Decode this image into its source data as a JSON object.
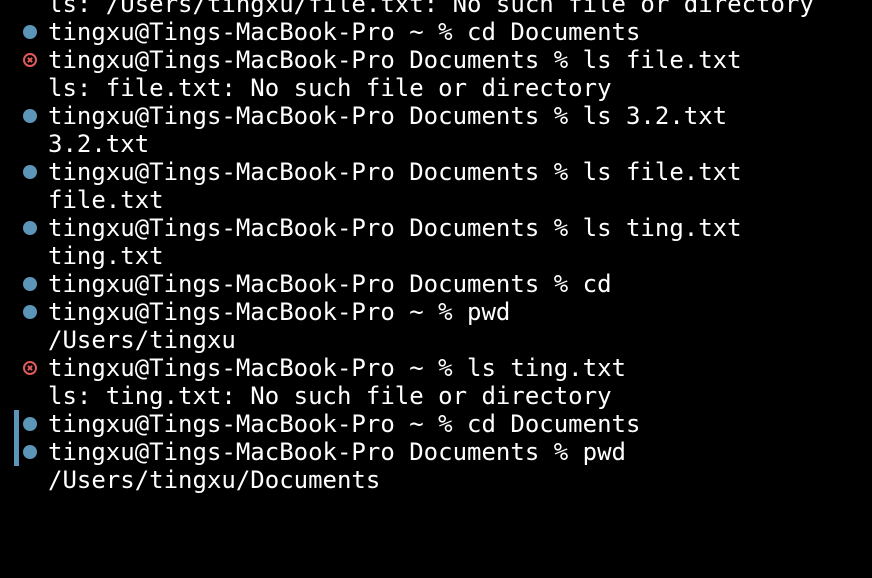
{
  "terminal": {
    "lines": [
      {
        "text": "ls: /Users/tingxu/file.txt: No such file or directory"
      },
      {
        "text": "tingxu@Tings-MacBook-Pro ~ % cd Documents"
      },
      {
        "text": "tingxu@Tings-MacBook-Pro Documents % ls file.txt"
      },
      {
        "text": "ls: file.txt: No such file or directory"
      },
      {
        "text": "tingxu@Tings-MacBook-Pro Documents % ls 3.2.txt"
      },
      {
        "text": "3.2.txt"
      },
      {
        "text": "tingxu@Tings-MacBook-Pro Documents % ls file.txt"
      },
      {
        "text": "file.txt"
      },
      {
        "text": "tingxu@Tings-MacBook-Pro Documents % ls ting.txt"
      },
      {
        "text": "ting.txt"
      },
      {
        "text": "tingxu@Tings-MacBook-Pro Documents % cd"
      },
      {
        "text": "tingxu@Tings-MacBook-Pro ~ % pwd"
      },
      {
        "text": "/Users/tingxu"
      },
      {
        "text": "tingxu@Tings-MacBook-Pro ~ % ls ting.txt"
      },
      {
        "text": "ls: ting.txt: No such file or directory"
      },
      {
        "text": "tingxu@Tings-MacBook-Pro ~ % cd Documents"
      },
      {
        "text": "tingxu@Tings-MacBook-Pro Documents % pwd"
      },
      {
        "text": "/Users/tingxu/Documents"
      }
    ]
  },
  "colors": {
    "background": "#000000",
    "foreground": "#ffffff",
    "success_marker": "#5b95b8",
    "error_marker": "#e05a5a"
  }
}
